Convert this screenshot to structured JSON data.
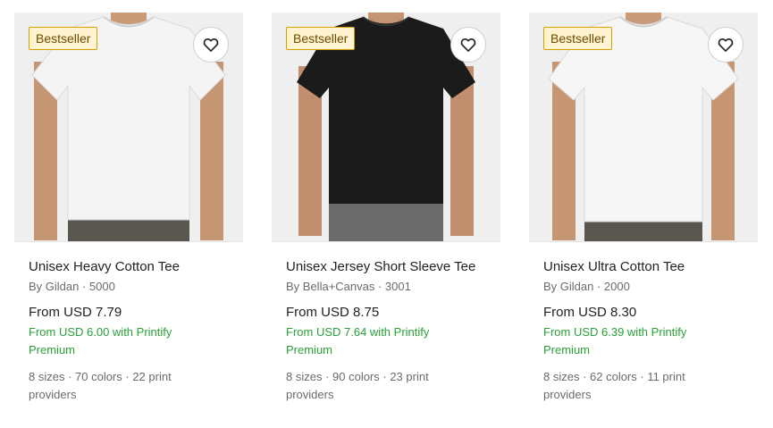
{
  "products": [
    {
      "badge": "Bestseller",
      "title": "Unisex Heavy Cotton Tee",
      "brand_line": "By Gildan · 5000",
      "price": "From USD 7.79",
      "premium_price": "From USD 6.00 with Printify Premium",
      "specs": "8 sizes · 70 colors · 22 print providers",
      "shirt_color": "#f4f4f4"
    },
    {
      "badge": "Bestseller",
      "title": "Unisex Jersey Short Sleeve Tee",
      "brand_line": "By Bella+Canvas · 3001",
      "price": "From USD 8.75",
      "premium_price": "From USD 7.64 with Printify Premium",
      "specs": "8 sizes · 90 colors · 23 print providers",
      "shirt_color": "#1b1b1b"
    },
    {
      "badge": "Bestseller",
      "title": "Unisex Ultra Cotton Tee",
      "brand_line": "By Gildan · 2000",
      "price": "From USD 8.30",
      "premium_price": "From USD 6.39 with Printify Premium",
      "specs": "8 sizes · 62 colors · 11 print providers",
      "shirt_color": "#f6f6f6"
    }
  ],
  "icons": {
    "favorite": "heart-outline-icon"
  },
  "colors": {
    "premium_green": "#2aa038",
    "badge_border": "#d6a100",
    "badge_bg": "#fff3d0"
  }
}
